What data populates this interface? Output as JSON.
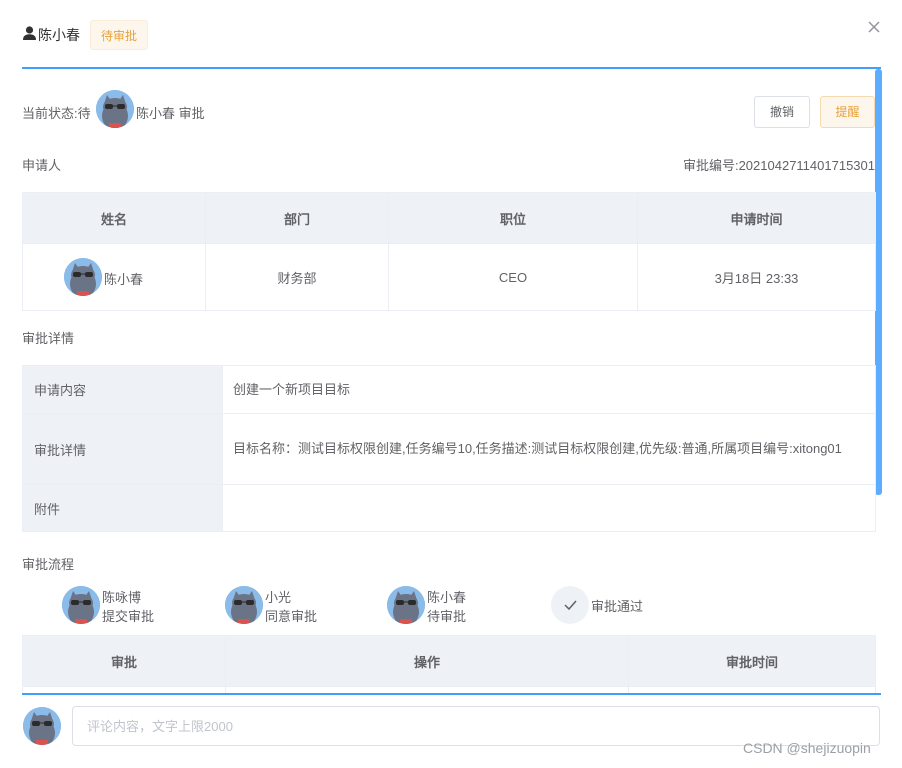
{
  "header": {
    "user_name": "陈小春",
    "status_tag": "待审批"
  },
  "status_bar": {
    "label": "当前状态:待",
    "approver_text": "陈小春 审批",
    "revoke_button": "撤销",
    "remind_button": "提醒"
  },
  "applicant": {
    "section_title": "申请人",
    "approval_no": "审批编号:2021042711401715301",
    "columns": [
      "姓名",
      "部门",
      "职位",
      "申请时间"
    ],
    "row": {
      "name": "陈小春",
      "department": "财务部",
      "position": "CEO",
      "apply_time": "3月18日 23:33"
    }
  },
  "details": {
    "section_title": "审批详情",
    "rows": [
      {
        "key": "申请内容",
        "value": "创建一个新项目目标"
      },
      {
        "key": "审批详情",
        "value": "目标名称：测试目标权限创建,任务编号10,任务描述:测试目标权限创建,优先级:普通,所属项目编号:xitong01"
      },
      {
        "key": "附件",
        "value": ""
      }
    ]
  },
  "flow": {
    "section_title": "审批流程",
    "steps": [
      {
        "name": "陈咏博",
        "action": "提交审批"
      },
      {
        "name": "小光",
        "action": "同意审批"
      },
      {
        "name": "陈小春",
        "action": "待审批"
      },
      {
        "name": "审批通过",
        "action": ""
      }
    ],
    "columns": [
      "审批",
      "操作",
      "审批时间"
    ]
  },
  "comment": {
    "placeholder": "评论内容，文字上限2000"
  },
  "watermark": "CSDN @shejizuopin",
  "colors": {
    "primary": "#409eff",
    "warning": "#e6a23c",
    "table_header_bg": "#eef1f6"
  }
}
